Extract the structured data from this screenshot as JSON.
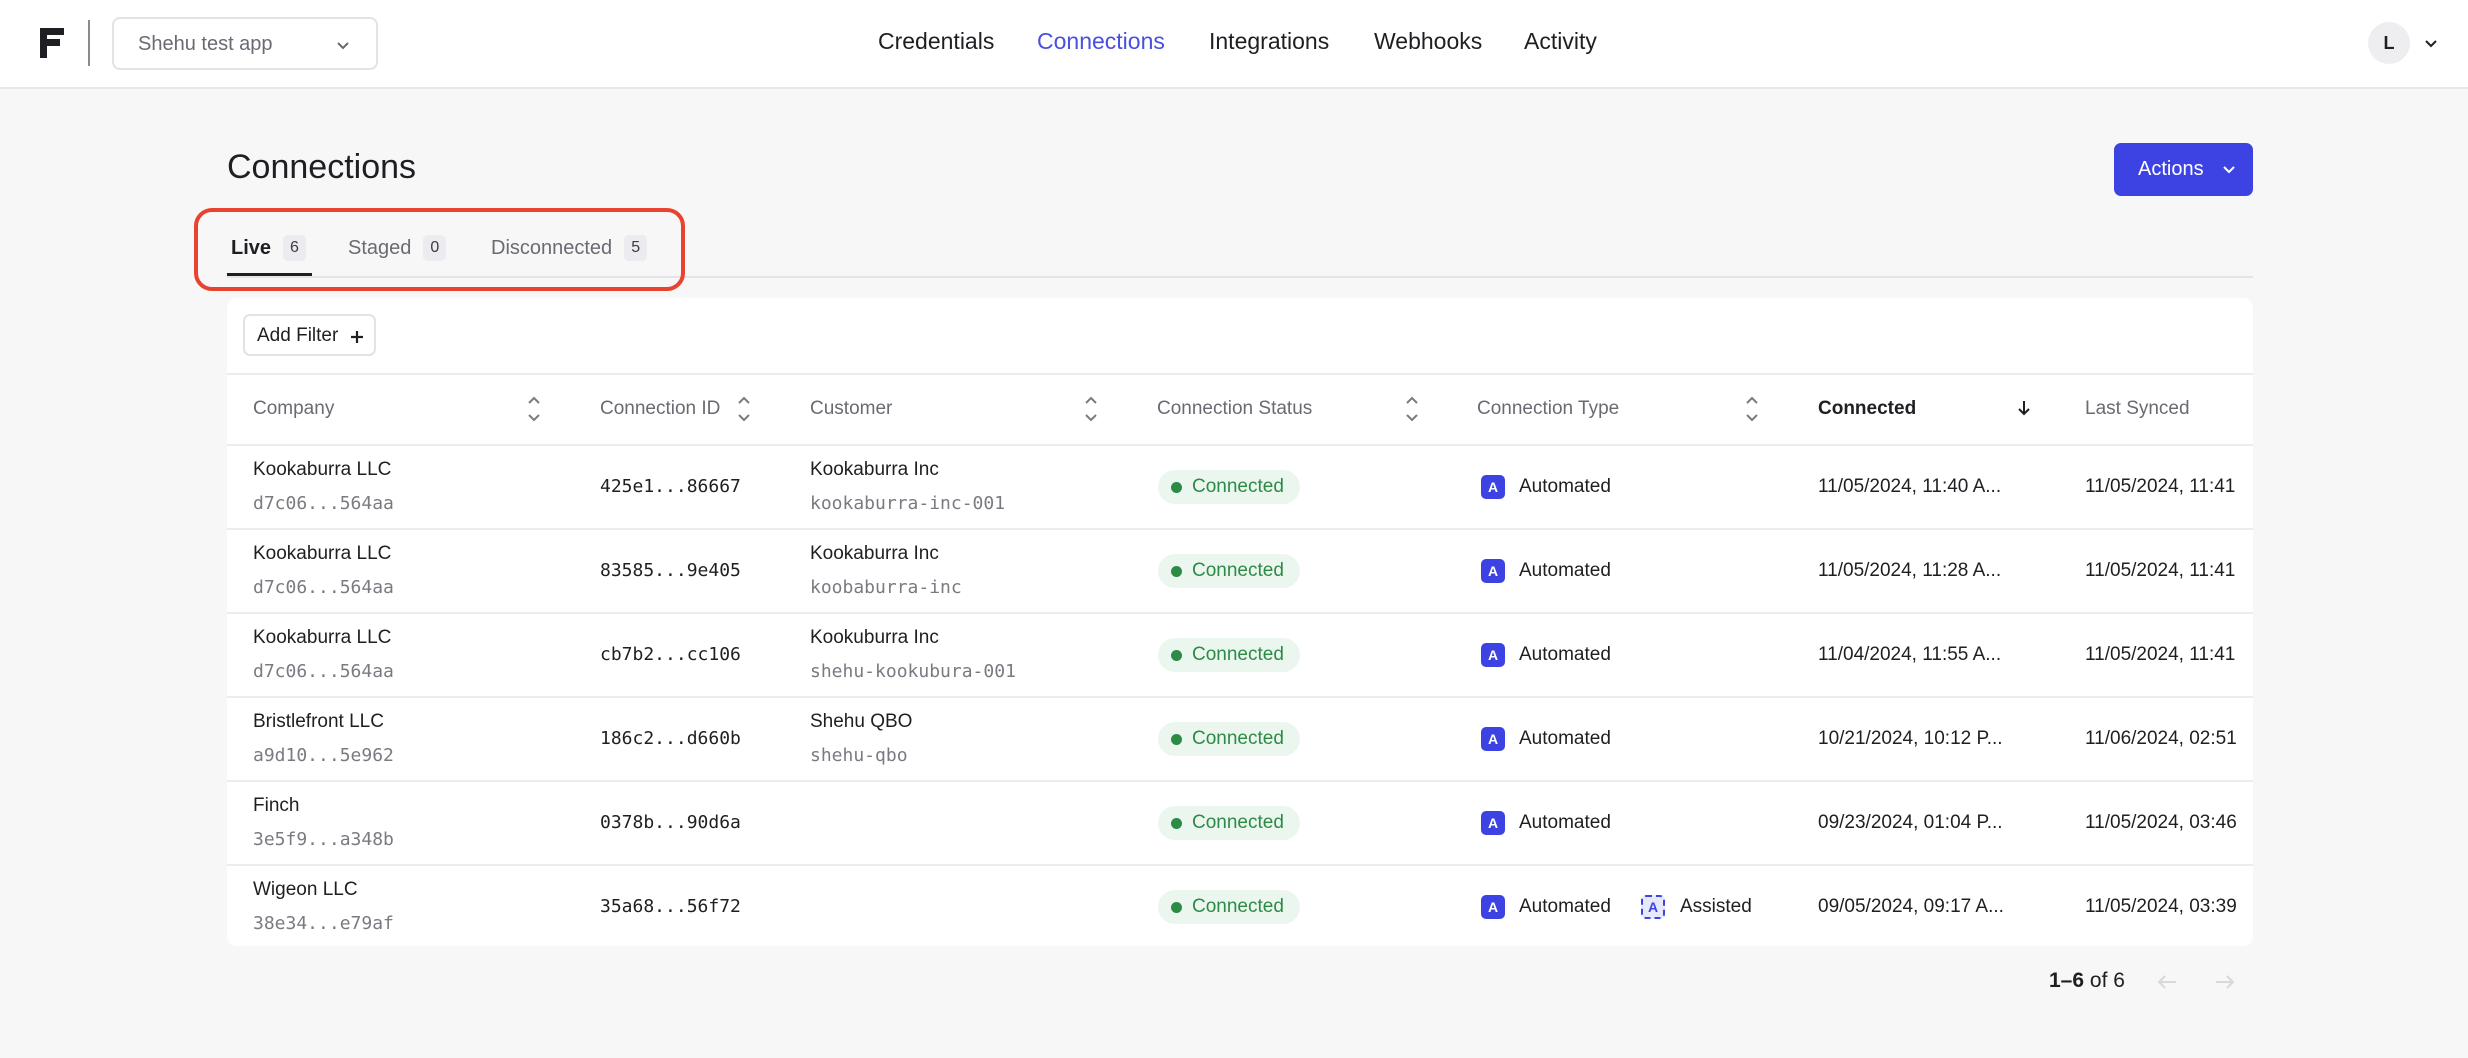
{
  "app_select": {
    "label": "Shehu test app"
  },
  "nav": [
    "Credentials",
    "Connections",
    "Integrations",
    "Webhooks",
    "Activity"
  ],
  "user": {
    "initial": "L"
  },
  "page": {
    "title": "Connections",
    "actions_label": "Actions"
  },
  "tabs": [
    {
      "label": "Live",
      "count": "6"
    },
    {
      "label": "Staged",
      "count": "0"
    },
    {
      "label": "Disconnected",
      "count": "5"
    }
  ],
  "filter": {
    "label": "Add Filter"
  },
  "columns": [
    "Company",
    "Connection ID",
    "Customer",
    "Connection Status",
    "Connection Type",
    "Connected",
    "Last Synced"
  ],
  "rows": [
    {
      "company": "Kookaburra LLC",
      "company_id": "d7c06...564aa",
      "connection_id": "425e1...86667",
      "customer": "Kookaburra Inc",
      "customer_id": "kookaburra-inc-001",
      "status": "Connected",
      "type": "Automated",
      "type2": "",
      "connected": "11/05/2024, 11:40 A...",
      "last_synced": "11/05/2024, 11:41"
    },
    {
      "company": "Kookaburra LLC",
      "company_id": "d7c06...564aa",
      "connection_id": "83585...9e405",
      "customer": "Kookaburra Inc",
      "customer_id": "koobaburra-inc",
      "status": "Connected",
      "type": "Automated",
      "type2": "",
      "connected": "11/05/2024, 11:28 A...",
      "last_synced": "11/05/2024, 11:41"
    },
    {
      "company": "Kookaburra LLC",
      "company_id": "d7c06...564aa",
      "connection_id": "cb7b2...cc106",
      "customer": "Kookuburra Inc",
      "customer_id": "shehu-kookubura-001",
      "status": "Connected",
      "type": "Automated",
      "type2": "",
      "connected": "11/04/2024, 11:55 A...",
      "last_synced": "11/05/2024, 11:41"
    },
    {
      "company": "Bristlefront LLC",
      "company_id": "a9d10...5e962",
      "connection_id": "186c2...d660b",
      "customer": "Shehu QBO",
      "customer_id": "shehu-qbo",
      "status": "Connected",
      "type": "Automated",
      "type2": "",
      "connected": "10/21/2024, 10:12 P...",
      "last_synced": "11/06/2024, 02:51"
    },
    {
      "company": "Finch",
      "company_id": "3e5f9...a348b",
      "connection_id": "0378b...90d6a",
      "customer": "",
      "customer_id": "",
      "status": "Connected",
      "type": "Automated",
      "type2": "",
      "connected": "09/23/2024, 01:04 P...",
      "last_synced": "11/05/2024, 03:46"
    },
    {
      "company": "Wigeon LLC",
      "company_id": "38e34...e79af",
      "connection_id": "35a68...56f72",
      "customer": "",
      "customer_id": "",
      "status": "Connected",
      "type": "Automated",
      "type2": "Assisted",
      "connected": "09/05/2024, 09:17 A...",
      "last_synced": "11/05/2024, 03:39"
    }
  ],
  "icons": {
    "automated": "A",
    "assisted": "A"
  },
  "pagination": {
    "range": "1–6",
    "of_text": "of 6"
  },
  "colors": {
    "accent": "#3d43e3",
    "highlight": "#e8432e",
    "status_green": "#2d8a47"
  }
}
